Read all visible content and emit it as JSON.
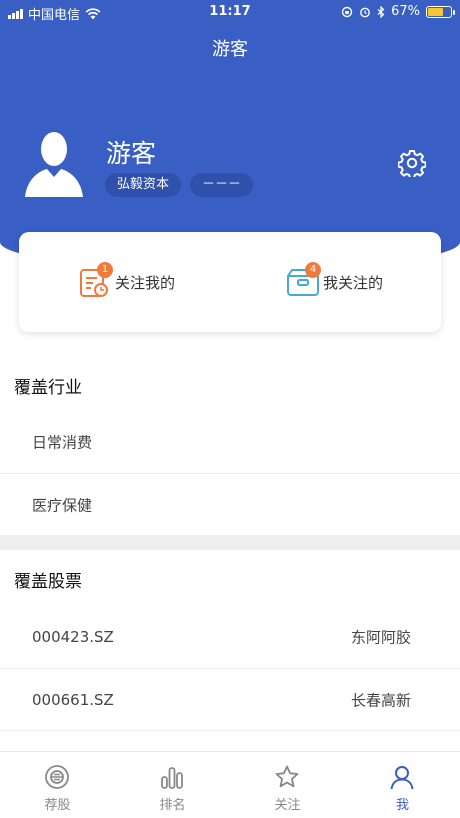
{
  "status_bar": {
    "carrier": "中国电信",
    "time": "11:17",
    "battery": "67%",
    "battery_level": 0.67
  },
  "nav": {
    "title": "游客"
  },
  "profile": {
    "name": "游客",
    "company_tag": "弘毅资本",
    "position_tag": "－－－"
  },
  "card": {
    "followers": {
      "label": "关注我的",
      "badge": "1"
    },
    "following": {
      "label": "我关注的",
      "badge": "4"
    }
  },
  "industries": {
    "title": "覆盖行业",
    "items": [
      "日常消费",
      "医疗保健"
    ]
  },
  "stocks": {
    "title": "覆盖股票",
    "items": [
      {
        "code": "000423.SZ",
        "name": "东阿阿胶"
      },
      {
        "code": "000661.SZ",
        "name": "长春高新"
      }
    ]
  },
  "tabs": [
    {
      "label": "荐股",
      "icon": "stock-pick-icon"
    },
    {
      "label": "排名",
      "icon": "ranking-icon"
    },
    {
      "label": "关注",
      "icon": "star-icon"
    },
    {
      "label": "我",
      "icon": "person-icon"
    }
  ],
  "colors": {
    "primary": "#3a5fc4",
    "badge": "#ef7a3a",
    "battery": "#f7c631"
  }
}
